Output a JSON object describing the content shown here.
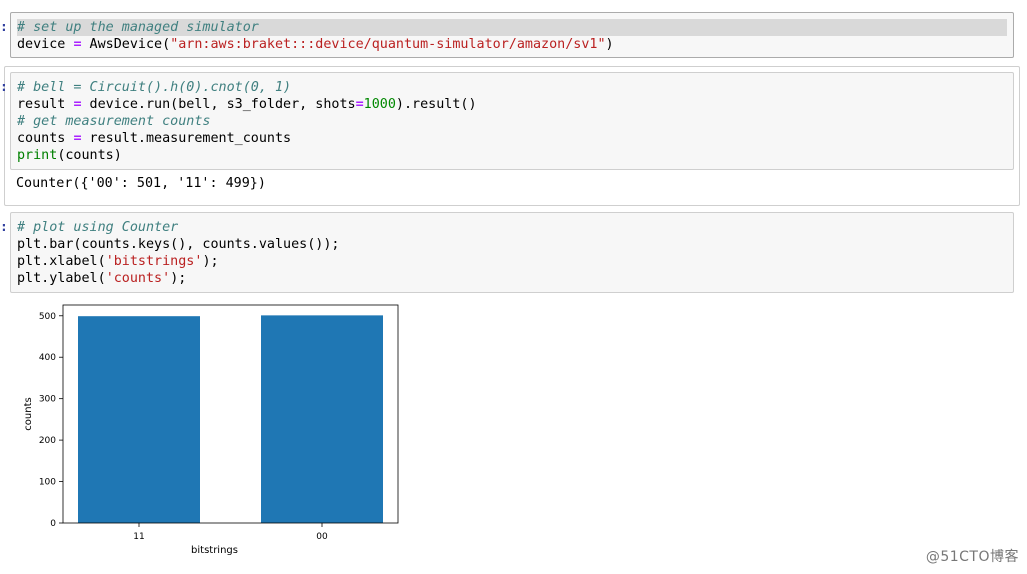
{
  "cells": [
    {
      "prompt": ":",
      "lines": [
        {
          "parts": [
            {
              "t": "# set up the managed simulator",
              "c": "cm-comment"
            }
          ],
          "hl": true
        },
        {
          "parts": [
            {
              "t": "device ",
              "c": ""
            },
            {
              "t": "=",
              "c": "cm-op"
            },
            {
              "t": " AwsDevice(",
              "c": ""
            },
            {
              "t": "\"arn:aws:braket:::device/quantum-simulator/amazon/sv1\"",
              "c": "cm-str"
            },
            {
              "t": ")",
              "c": ""
            }
          ],
          "hl": false
        }
      ]
    },
    {
      "prompt": ":",
      "lines": [
        {
          "parts": [
            {
              "t": "# bell = Circuit().h(0).cnot(0, 1)",
              "c": "cm-comment"
            }
          ]
        },
        {
          "parts": [
            {
              "t": "result ",
              "c": ""
            },
            {
              "t": "=",
              "c": "cm-op"
            },
            {
              "t": " device.run(bell, s3_folder, shots",
              "c": ""
            },
            {
              "t": "=",
              "c": "cm-op"
            },
            {
              "t": "1000",
              "c": "cm-num"
            },
            {
              "t": ").result()",
              "c": ""
            }
          ]
        },
        {
          "parts": [
            {
              "t": "# get measurement counts",
              "c": "cm-comment"
            }
          ]
        },
        {
          "parts": [
            {
              "t": "counts ",
              "c": ""
            },
            {
              "t": "=",
              "c": "cm-op"
            },
            {
              "t": " result.measurement_counts",
              "c": ""
            }
          ]
        },
        {
          "parts": [
            {
              "t": "print",
              "c": "cm-kw"
            },
            {
              "t": "(counts)",
              "c": ""
            }
          ]
        }
      ],
      "output": "Counter({'00': 501, '11': 499})"
    },
    {
      "prompt": ":",
      "lines": [
        {
          "parts": [
            {
              "t": "# plot using Counter",
              "c": "cm-comment"
            }
          ]
        },
        {
          "parts": [
            {
              "t": "plt.bar(counts.keys(), counts.values());",
              "c": ""
            }
          ]
        },
        {
          "parts": [
            {
              "t": "plt.xlabel(",
              "c": ""
            },
            {
              "t": "'bitstrings'",
              "c": "cm-str"
            },
            {
              "t": ");",
              "c": ""
            }
          ]
        },
        {
          "parts": [
            {
              "t": "plt.ylabel(",
              "c": ""
            },
            {
              "t": "'counts'",
              "c": "cm-str"
            },
            {
              "t": ");",
              "c": ""
            }
          ]
        }
      ]
    }
  ],
  "chart_data": {
    "type": "bar",
    "categories": [
      "11",
      "00"
    ],
    "values": [
      499,
      501
    ],
    "xlabel": "bitstrings",
    "ylabel": "counts",
    "ylim": [
      0,
      526
    ],
    "yticks": [
      0,
      100,
      200,
      300,
      400,
      500
    ],
    "bar_color": "#1f77b4",
    "grid": false
  },
  "watermark": "@51CTO博客"
}
